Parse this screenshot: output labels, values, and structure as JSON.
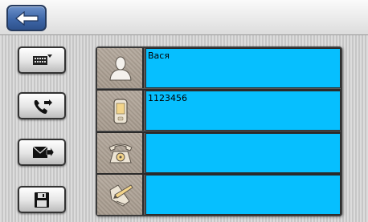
{
  "header": {
    "back_icon": "back-arrow-icon"
  },
  "sidebar": {
    "buttons": [
      {
        "icon": "keyboard-icon"
      },
      {
        "icon": "phone-transfer-icon"
      },
      {
        "icon": "send-message-icon"
      },
      {
        "icon": "save-floppy-icon"
      }
    ]
  },
  "contact": {
    "name": {
      "icon": "person-icon",
      "value": "Вася"
    },
    "mobile": {
      "icon": "mobile-phone-icon",
      "value": "1123456"
    },
    "phone": {
      "icon": "desk-phone-icon",
      "value": ""
    },
    "note": {
      "icon": "pen-note-icon",
      "value": ""
    }
  },
  "colors": {
    "field_bg": "#06bfff",
    "icon_cell_bg": "#a89c8f",
    "back_button": "#3e67a8"
  }
}
